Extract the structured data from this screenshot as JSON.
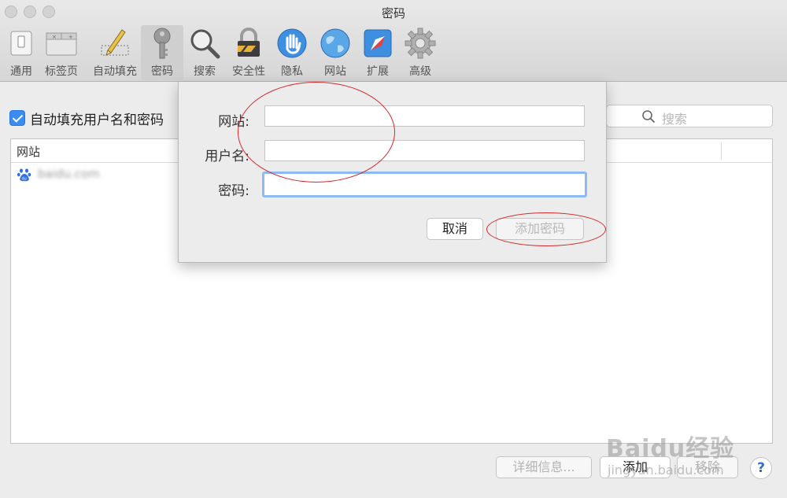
{
  "window": {
    "title": "密码"
  },
  "toolbar": {
    "items": [
      {
        "label": "通用",
        "icon": "switch-icon"
      },
      {
        "label": "标签页",
        "icon": "tabs-icon"
      },
      {
        "label": "自动填充",
        "icon": "pencil-form-icon"
      },
      {
        "label": "密码",
        "icon": "key-icon",
        "active": true
      },
      {
        "label": "搜索",
        "icon": "magnifier-icon"
      },
      {
        "label": "安全性",
        "icon": "padlock-icon"
      },
      {
        "label": "隐私",
        "icon": "hand-icon"
      },
      {
        "label": "网站",
        "icon": "globe-icon"
      },
      {
        "label": "扩展",
        "icon": "puzzle-icon"
      },
      {
        "label": "高级",
        "icon": "gear-icon"
      }
    ]
  },
  "autofill": {
    "label": "自动填充用户名和密码",
    "checked": true
  },
  "search": {
    "placeholder": "搜索"
  },
  "table": {
    "columns": [
      "网站"
    ],
    "rows": [
      {
        "site": "baidu.com"
      }
    ]
  },
  "bottom_buttons": {
    "details": "详细信息...",
    "add": "添加",
    "remove": "移除",
    "help": "?"
  },
  "dialog": {
    "website_label": "网站:",
    "username_label": "用户名:",
    "password_label": "密码:",
    "cancel": "取消",
    "add_password": "添加密码"
  },
  "watermark": {
    "text": "Baidu经验",
    "sub": "jingyan.baidu.com"
  },
  "colors": {
    "accent": "#3a8cf3",
    "annotation": "#d6282b"
  }
}
